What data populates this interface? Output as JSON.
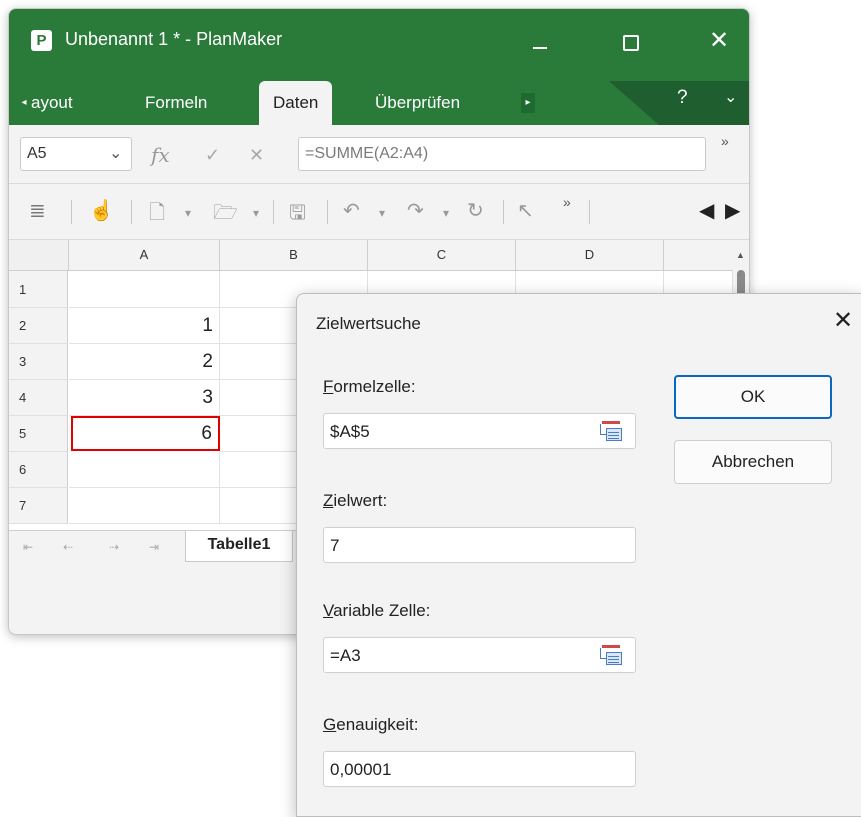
{
  "window": {
    "title": "Unbenannt 1 * - PlanMaker",
    "app_logo": "P",
    "close_glyph": "✕"
  },
  "ribbon": {
    "tabs": [
      "ayout",
      "Formeln",
      "Daten",
      "Überprüfen"
    ],
    "active_tab": "Daten",
    "help": "?",
    "collapse": "⌄"
  },
  "formula_bar": {
    "cell_ref": "A5",
    "fx": "fx",
    "formula": "=SUMME(A2:A4)",
    "more": "»"
  },
  "toolbar": {
    "icons": [
      "align-icon",
      "hand-icon",
      "new-file-icon",
      "open-folder-icon",
      "save-icon",
      "undo-icon",
      "redo-icon",
      "repeat-icon",
      "select-icon"
    ],
    "more": "»"
  },
  "grid": {
    "columns": [
      "A",
      "B",
      "C",
      "D"
    ],
    "rows": [
      "1",
      "2",
      "3",
      "4",
      "5",
      "6",
      "7"
    ],
    "colA": [
      "",
      "1",
      "2",
      "3",
      "6",
      "",
      ""
    ],
    "selected_cell": "A5"
  },
  "sheet_tabs": {
    "active": "Tabelle1"
  },
  "dialog": {
    "title": "Zielwertsuche",
    "formula_cell": {
      "label_u": "F",
      "label_rest": "ormelzelle:",
      "value": "$A$5"
    },
    "target_value": {
      "label_u": "Z",
      "label_rest": "ielwert:",
      "value": "7"
    },
    "variable_cell": {
      "label_u": "V",
      "label_rest": "ariable Zelle:",
      "value": "=A3"
    },
    "precision": {
      "label_u": "G",
      "label_rest": "enauigkeit:",
      "value": "0,00001"
    },
    "ok": "OK",
    "cancel": "Abbrechen",
    "close": "✕"
  },
  "colors": {
    "brand_green": "#2a7a3a",
    "selection_red": "#e00000",
    "ok_focus_blue": "#0b67c0"
  }
}
